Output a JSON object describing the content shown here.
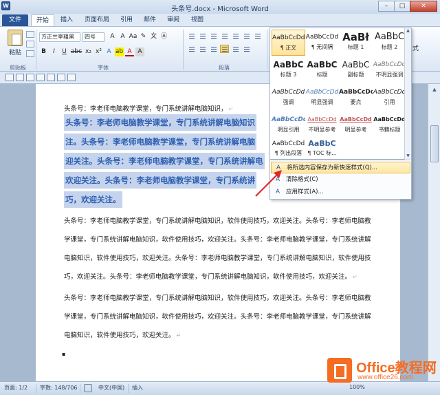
{
  "window": {
    "title": "头条号.docx - Microsoft Word",
    "minimize": "–",
    "maximize": "□",
    "close": "✕"
  },
  "tabs": [
    {
      "label": "文件"
    },
    {
      "label": "开始"
    },
    {
      "label": "插入"
    },
    {
      "label": "页面布局"
    },
    {
      "label": "引用"
    },
    {
      "label": "邮件"
    },
    {
      "label": "审阅"
    },
    {
      "label": "视图"
    }
  ],
  "ribbon": {
    "paste_label": "粘贴",
    "font_name": "方正兰亭粗黑",
    "font_size": "四号",
    "groups": {
      "clipboard": "剪贴板",
      "font": "字体",
      "paragraph": "段落"
    },
    "format_buttons": [
      "B",
      "I",
      "U",
      "abc",
      "x₂",
      "x²",
      "A",
      "ab",
      "A",
      "A"
    ],
    "side_text": "式"
  },
  "styles_gallery": [
    {
      "sample": "AaBbCcDd",
      "name": "¶ 正文"
    },
    {
      "sample": "AaBbCcDd",
      "name": "¶ 无间隔"
    },
    {
      "sample": "AaBł",
      "name": "标题 1"
    },
    {
      "sample": "AaBbC",
      "name": "标题 2"
    },
    {
      "sample": "AaBbC",
      "name": "标题 3"
    },
    {
      "sample": "AaBbC",
      "name": "标题"
    },
    {
      "sample": "AaBbC",
      "name": "副标题"
    },
    {
      "sample": "AaBbCcDd",
      "name": "不明显强调"
    },
    {
      "sample": "AaBbCcDd",
      "name": "强调"
    },
    {
      "sample": "AaBbCcDd",
      "name": "明显强调"
    },
    {
      "sample": "AaBbCcDd",
      "name": "要点"
    },
    {
      "sample": "AaBbCcDd",
      "name": "引用"
    },
    {
      "sample": "AaBbCcDd",
      "name": "明显引用"
    },
    {
      "sample": "AaBbCcDd",
      "name": "不明显参考"
    },
    {
      "sample": "AaBbCcDd",
      "name": "明显参考"
    },
    {
      "sample": "AaBbCcDd",
      "name": "书籍标题"
    },
    {
      "sample": "AaBbCcDd",
      "name": "¶ 列出段落"
    },
    {
      "sample": "AaBbC",
      "name": "¶ TOC 标..."
    }
  ],
  "styles_menu": [
    {
      "label": "将所选内容保存为新快速样式(Q)...",
      "icon": "save-style-icon"
    },
    {
      "label": "清除格式(C)",
      "icon": "clear-format-icon"
    },
    {
      "label": "应用样式(A)...",
      "icon": "apply-style-icon"
    }
  ],
  "document": {
    "first_line": "头条号：李老师电脑教学课堂，专门系统讲解电脑知识，",
    "selected_lines": [
      "头条号：李老师电脑教学课堂，专门系统讲解电脑知识",
      "注。头条号：李老师电脑教学课堂，专门系统讲解电脑",
      "迎关注。头条号：李老师电脑教学课堂，专门系统讲解电",
      "欢迎关注。头条号：李老师电脑教学课堂，专门系统讲",
      "巧，欢迎关注。"
    ],
    "paragraph2": [
      "头条号：李老师电脑教学课堂，专门系统讲解电脑知识，软件使用技巧，欢迎关注。头条号：李老师电脑教",
      "学课堂，专门系统讲解电脑知识，软件使用技巧，欢迎关注。头条号：李老师电脑教学课堂，专门系统讲解",
      "电脑知识，软件使用技巧，欢迎关注。头条号：李老师电脑教学课堂，专门系统讲解电脑知识，软件使用技",
      "巧，欢迎关注。头条号：李老师电脑教学课堂，专门系统讲解电脑知识，软件使用技巧，欢迎关注。"
    ],
    "paragraph3": [
      "头条号：李老师电脑教学课堂，专门系统讲解电脑知识，软件使用技巧，欢迎关注。头条号：李老师电脑教",
      "学课堂，专门系统讲解电脑知识，软件使用技巧，欢迎关注。头条号：李老师电脑教学课堂，专门系统讲解",
      "电脑知识，软件使用技巧，欢迎关注。"
    ],
    "paragraph_mark": "↵",
    "bullet": "▪"
  },
  "statusbar": {
    "page": "页面: 1/2",
    "words": "字数: 148/706",
    "lang": "中文(中国)",
    "mode": "插入",
    "zoom": "100%"
  },
  "watermark": {
    "brand": "Office教程网",
    "url": "www.office26.com"
  },
  "colors": {
    "accent": "#2b579a",
    "selection": "#c5d4ec",
    "selected_text": "#2e5fb2",
    "highlight": "#f8d77a",
    "watermark": "#f46d22"
  }
}
